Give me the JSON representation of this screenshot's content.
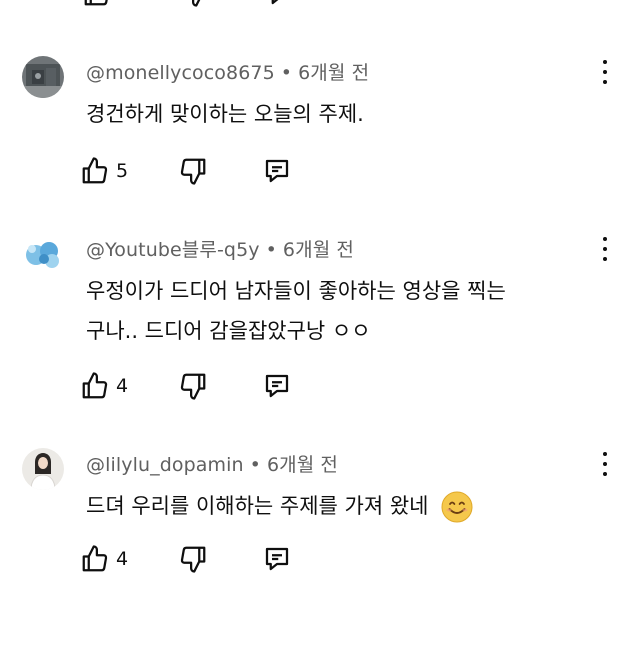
{
  "comments": [
    {
      "author": "@monellycoco8675",
      "separator": "•",
      "time": "6개월 전",
      "text": "경건하게 맞이하는 오늘의 주제.",
      "likes": "5"
    },
    {
      "author": "@Youtube블루-q5y",
      "separator": "•",
      "time": "6개월 전",
      "text_line1": "우정이가 드디어 남자들이 좋아하는 영상을 찍는",
      "text_line2": "구나.. 드디어 감을잡았구낭 ㅇㅇ",
      "likes": "4"
    },
    {
      "author": "@lilylu_dopamin",
      "separator": "•",
      "time": "6개월 전",
      "text": "드뎌 우리를 이해하는 주제를 가져 왔네",
      "emoji": "smiling-face-emoji",
      "likes": "4"
    }
  ],
  "icons": {
    "like": "thumbs-up-icon",
    "dislike": "thumbs-down-icon",
    "reply": "reply-comment-icon",
    "more": "more-vertical-icon"
  },
  "colors": {
    "text": "#0f0f0f",
    "meta": "#606060",
    "emoji": "#f5c84c"
  }
}
